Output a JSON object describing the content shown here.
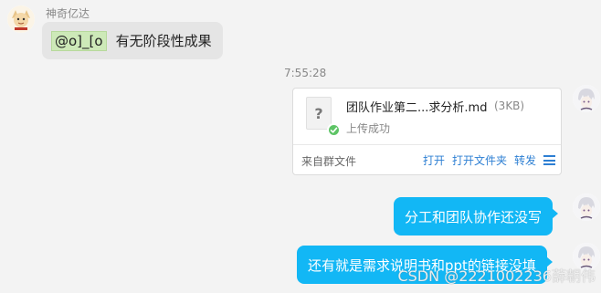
{
  "incoming": {
    "sender": "神奇亿达",
    "mention": "@o]_[o",
    "text": "有无阶段性成果"
  },
  "timestamp": "7:55:28",
  "file_card": {
    "icon_glyph": "?",
    "file_name": "团队作业第二...求分析.md",
    "file_size": "(3KB)",
    "status": "上传成功",
    "source": "来自群文件",
    "actions": [
      "打开",
      "打开文件夹",
      "转发"
    ]
  },
  "outgoing": [
    "分工和团队协作还没写",
    "还有就是需求说明书和ppt的链接没填"
  ],
  "watermark": "CSDN @2221002236薛朝伟",
  "colors": {
    "outgoing_bubble": "#12b7f5",
    "incoming_bubble": "#e5e5e5",
    "link": "#2d7fd3",
    "success_check": "#5dc465"
  }
}
